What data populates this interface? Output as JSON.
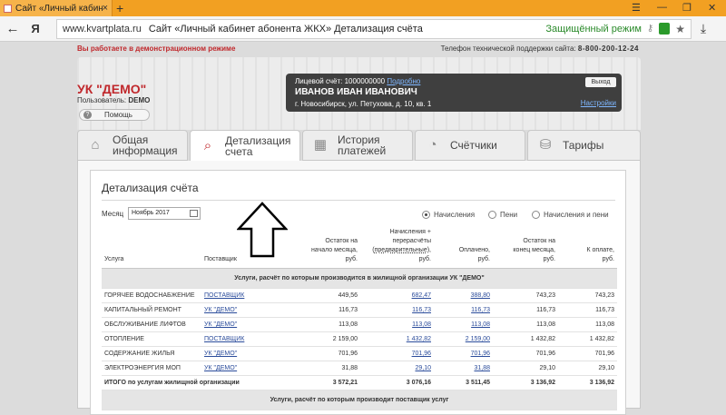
{
  "browser": {
    "tab_title": "Сайт «Личный кабинет а",
    "url_host": "www.kvartplata.ru",
    "page_title": "Сайт «Личный кабинет абонента ЖКХ» Детализация счёта",
    "secure_label": "Защищённый режим",
    "yandex_logo": "Я"
  },
  "top": {
    "demo_notice": "Вы работаете в демонстрационном режиме",
    "support_label": "Телефон технической поддержки сайта:",
    "support_phone": "8-800-200-12-24"
  },
  "header": {
    "company": "УК \"ДЕМО\"",
    "user_label": "Пользователь:",
    "user_name": "DEMO",
    "help_label": "Помощь",
    "account_label": "Лицевой счёт: 1000000000",
    "account_more": "Подробно",
    "holder_name": "ИВАНОВ ИВАН ИВАНОВИЧ",
    "address": "г. Новосибирск, ул. Петухова, д. 10, кв. 1",
    "exit_label": "Выход",
    "settings_label": "Настройки"
  },
  "nav": {
    "tabs": [
      {
        "line1": "Общая",
        "line2": "информация"
      },
      {
        "line1": "Детализация",
        "line2": "счета"
      },
      {
        "line1": "История",
        "line2": "платежей"
      },
      {
        "line1": "Счётчики",
        "line2": ""
      },
      {
        "line1": "Тарифы",
        "line2": ""
      }
    ]
  },
  "detail": {
    "title": "Детализация счёта",
    "month_label": "Месяц",
    "month_value": "Ноябрь 2017",
    "radio_accruals": "Начисления",
    "radio_penalties": "Пени",
    "radio_both": "Начисления и пени"
  },
  "table": {
    "headers": {
      "service": "Услуга",
      "supplier": "Поставщик",
      "opening_1": "Остаток на",
      "opening_2": "начало месяца,",
      "opening_3": "руб.",
      "charges_1": "Начисления +",
      "charges_2": "перерасчёты",
      "charges_3a": "(",
      "charges_3b": "предварительные",
      "charges_3c": "),",
      "charges_4": "руб.",
      "paid_1": "Оплачено,",
      "paid_2": "руб.",
      "closing_1": "Остаток на",
      "closing_2": "конец месяца,",
      "closing_3": "руб.",
      "topay_1": "К оплате,",
      "topay_2": "руб."
    },
    "section1": "Услуги, расчёт по которым производится в жилищной организации УК \"ДЕМО\"",
    "rows": [
      {
        "service": "ГОРЯЧЕЕ ВОДОСНАБЖЕНИЕ",
        "supplier": "ПОСТАВЩИК",
        "opening": "449,56",
        "charges": "682,47",
        "paid": "388,80",
        "closing": "743,23",
        "topay": "743,23"
      },
      {
        "service": "КАПИТАЛЬНЫЙ РЕМОНТ",
        "supplier": "УК \"ДЕМО\"",
        "opening": "116,73",
        "charges": "116,73",
        "paid": "116,73",
        "closing": "116,73",
        "topay": "116,73"
      },
      {
        "service": "ОБСЛУЖИВАНИЕ ЛИФТОВ",
        "supplier": "УК \"ДЕМО\"",
        "opening": "113,08",
        "charges": "113,08",
        "paid": "113,08",
        "closing": "113,08",
        "topay": "113,08"
      },
      {
        "service": "ОТОПЛЕНИЕ",
        "supplier": "ПОСТАВЩИК",
        "opening": "2 159,00",
        "charges": "1 432,82",
        "paid": "2 159,00",
        "closing": "1 432,82",
        "topay": "1 432,82"
      },
      {
        "service": "СОДЕРЖАНИЕ ЖИЛЬЯ",
        "supplier": "УК \"ДЕМО\"",
        "opening": "701,96",
        "charges": "701,96",
        "paid": "701,96",
        "closing": "701,96",
        "topay": "701,96"
      },
      {
        "service": "ЭЛЕКТРОЭНЕРГИЯ МОП",
        "supplier": "УК \"ДЕМО\"",
        "opening": "31,88",
        "charges": "29,10",
        "paid": "31,88",
        "closing": "29,10",
        "topay": "29,10"
      }
    ],
    "total": {
      "label": "ИТОГО по услугам жилищной организации",
      "opening": "3 572,21",
      "charges": "3 076,16",
      "paid": "3 511,45",
      "closing": "3 136,92",
      "topay": "3 136,92"
    },
    "section2": "Услуги, расчёт по которым производит поставщик услуг"
  },
  "colors": {
    "brand_red": "#c0282c",
    "link_blue": "#2b4c9b",
    "browser_orange": "#f2a022"
  }
}
